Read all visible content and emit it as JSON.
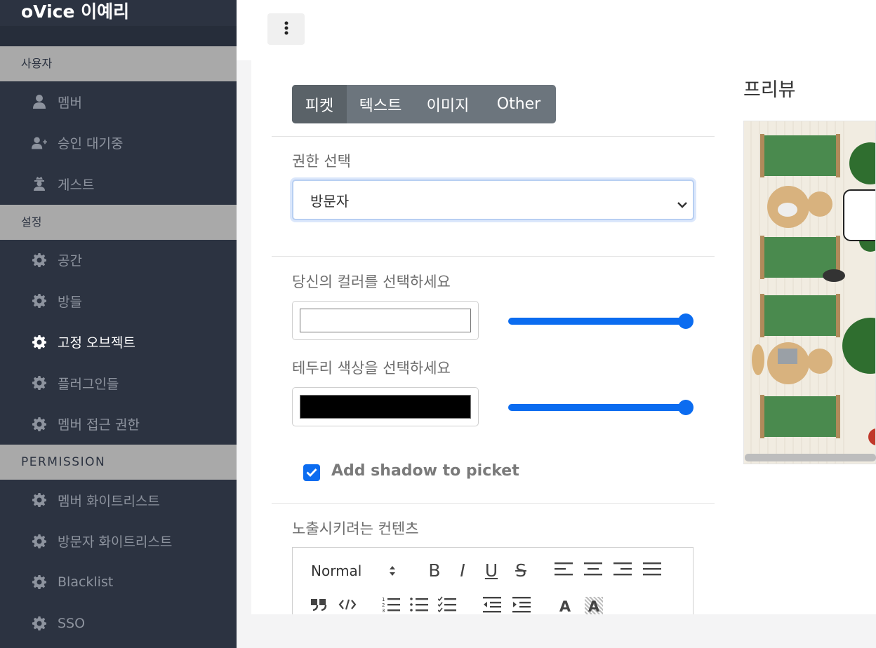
{
  "app": {
    "title": "oVice 이예리"
  },
  "sidebar": {
    "sections": [
      {
        "header": "사용자",
        "items": [
          {
            "label": "멤버"
          },
          {
            "label": "승인 대기중"
          },
          {
            "label": "게스트"
          }
        ]
      },
      {
        "header": "설정",
        "items": [
          {
            "label": "공간"
          },
          {
            "label": "방들"
          },
          {
            "label": "고정 오브젝트"
          },
          {
            "label": "플러그인들"
          },
          {
            "label": "멤버 접근 권한"
          }
        ]
      },
      {
        "header": "PERMISSION",
        "items": [
          {
            "label": "멤버 화이트리스트"
          },
          {
            "label": "방문자 화이트리스트"
          },
          {
            "label": "Blacklist"
          },
          {
            "label": "SSO"
          }
        ]
      }
    ],
    "active_item": "고정 오브젝트"
  },
  "tabs": [
    {
      "label": "피켓"
    },
    {
      "label": "텍스트"
    },
    {
      "label": "이미지"
    },
    {
      "label": "Other"
    }
  ],
  "active_tab": "피켓",
  "form": {
    "role_label": "권한 선택",
    "role_value": "방문자",
    "color_label": "당신의 컬러를 선택하세요",
    "color_value": "#ffffff",
    "color_opacity_percent": 100,
    "border_label": "테두리 색상을 선택하세요",
    "border_value": "#000000",
    "border_opacity_percent": 100,
    "shadow_label": "Add shadow to picket",
    "shadow_checked": true,
    "content_label": "노출시키려는 컨텐츠"
  },
  "editor": {
    "header_select": "Normal",
    "toolbar_row1": [
      "bold",
      "italic",
      "underline",
      "strike",
      "align-left",
      "align-center",
      "align-right",
      "align-justify"
    ],
    "toolbar_row2": [
      "blockquote",
      "code",
      "ordered-list",
      "bullet-list",
      "check-list",
      "outdent",
      "indent",
      "text-color",
      "background-color"
    ],
    "bold_glyph": "B",
    "italic_glyph": "I",
    "underline_glyph": "U",
    "strike_glyph": "S",
    "color_glyph": "A",
    "bgcolor_glyph": "A"
  },
  "preview": {
    "title": "프리뷰"
  },
  "colors": {
    "sidebar_bg": "#2c3341",
    "section_header_bg": "#a9a9a9",
    "accent": "#0b6cf0",
    "tab_bg": "#6c757d",
    "tab_active_bg": "#5a6268"
  }
}
